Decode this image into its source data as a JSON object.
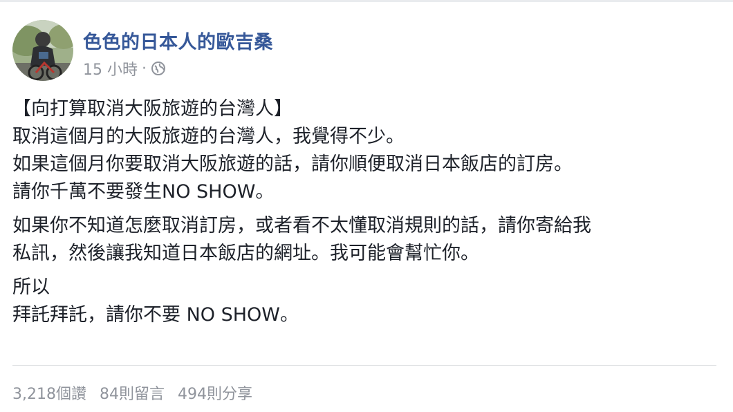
{
  "author": {
    "name": "色色的日本人的歐吉桑"
  },
  "meta": {
    "time": "15 小時",
    "separator": "·",
    "privacy_icon": "globe-icon"
  },
  "post": {
    "paragraphs": [
      {
        "lines": [
          "【向打算取消大阪旅遊的台灣人】",
          "取消這個月的大阪旅遊的台灣人，我覺得不少。",
          "如果這個月你要取消大阪旅遊的話，請你順便取消日本飯店的訂房。",
          "請你千萬不要發生NO SHOW。"
        ]
      },
      {
        "lines": [
          "如果你不知道怎麼取消訂房，或者看不太懂取消規則的話，請你寄給我",
          "私訊，然後讓我知道日本飯店的網址。我可能會幫忙你。"
        ]
      },
      {
        "lines": [
          "所以",
          "拜託拜託，請你不要 NO SHOW。"
        ]
      }
    ]
  },
  "stats": {
    "likes": "3,218個讚",
    "comments": "84則留言",
    "shares": "494則分享"
  },
  "colors": {
    "author_link": "#365899",
    "meta_text": "#90949c",
    "body_text": "#1d2129",
    "divider": "#dddfe2"
  }
}
